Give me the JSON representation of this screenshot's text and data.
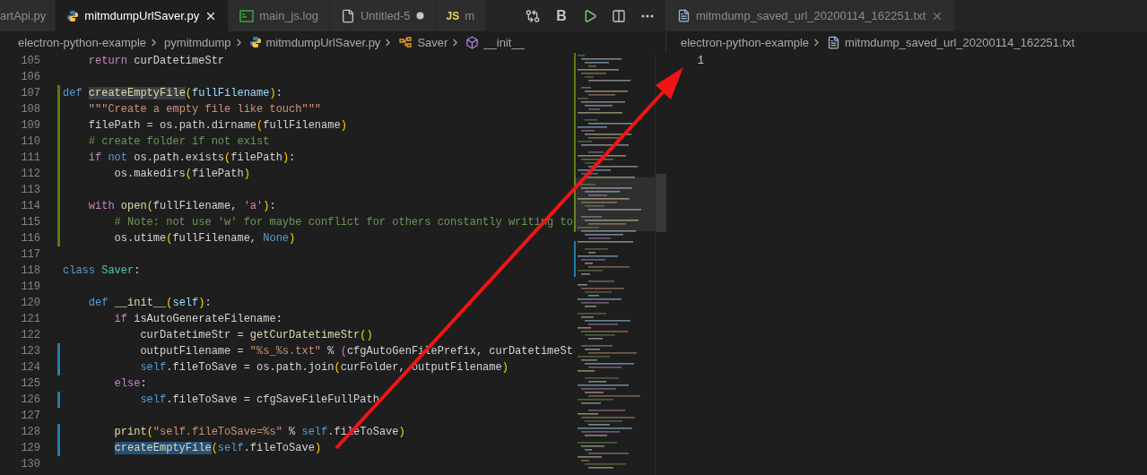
{
  "left_editor": {
    "tabs": [
      {
        "label": "artApi.py",
        "kind": "plain",
        "selected": false,
        "unsaved": false
      },
      {
        "label": "mitmdumpUrlSaver.py",
        "kind": "python",
        "selected": true,
        "unsaved": false
      },
      {
        "label": "main_js.log",
        "kind": "log",
        "selected": false,
        "unsaved": false
      },
      {
        "label": "Untitled-5",
        "kind": "file",
        "selected": false,
        "unsaved": true
      },
      {
        "label": "m",
        "kind": "js",
        "badge": "JS",
        "selected": false,
        "unsaved": false
      }
    ],
    "toolbar": [
      {
        "kind": "compare"
      },
      {
        "kind": "text",
        "label": "B"
      },
      {
        "kind": "run"
      },
      {
        "kind": "split"
      },
      {
        "kind": "more"
      }
    ],
    "breadcrumb": [
      {
        "label": "electron-python-example",
        "kind": "plain"
      },
      {
        "label": "pymitmdump",
        "kind": "plain"
      },
      {
        "label": "mitmdumpUrlSaver.py",
        "kind": "python"
      },
      {
        "label": "Saver",
        "kind": "class"
      },
      {
        "label": "__init__",
        "kind": "method"
      }
    ],
    "lines": [
      {
        "number": "105",
        "tokens": [
          {
            "text": "    return",
            "kind": "keyword"
          },
          {
            "text": " curDatetimeStr",
            "kind": "plain"
          }
        ]
      },
      {
        "number": "106"
      },
      {
        "number": "107",
        "added": true,
        "tokens": [
          {
            "text": "def ",
            "kind": "storage"
          },
          {
            "text": "createEmptyFile",
            "kind": "function",
            "occurrence": true
          },
          {
            "text": "(",
            "kind": "bracket"
          },
          {
            "text": "fullFilename",
            "kind": "param"
          },
          {
            "text": ")",
            "kind": "bracket"
          },
          {
            "text": ":",
            "kind": "plain"
          }
        ]
      },
      {
        "number": "108",
        "added": true,
        "tokens": [
          {
            "text": "    \"\"\"Create a empty file like touch\"\"\"",
            "kind": "string"
          }
        ]
      },
      {
        "number": "109",
        "added": true,
        "tokens": [
          {
            "text": "    filePath = os.path.dirname",
            "kind": "plain"
          },
          {
            "text": "(",
            "kind": "bracket"
          },
          {
            "text": "fullFilename",
            "kind": "plain"
          },
          {
            "text": ")",
            "kind": "bracket"
          }
        ]
      },
      {
        "number": "110",
        "added": true,
        "tokens": [
          {
            "text": "    # create folder if not exist",
            "kind": "comment"
          }
        ]
      },
      {
        "number": "111",
        "added": true,
        "tokens": [
          {
            "text": "    if ",
            "kind": "keyword"
          },
          {
            "text": "not",
            "kind": "storage"
          },
          {
            "text": " os.path.exists",
            "kind": "plain"
          },
          {
            "text": "(",
            "kind": "bracket"
          },
          {
            "text": "filePath",
            "kind": "plain"
          },
          {
            "text": ")",
            "kind": "bracket"
          },
          {
            "text": ":",
            "kind": "plain"
          }
        ]
      },
      {
        "number": "112",
        "added": true,
        "tokens": [
          {
            "text": "        os.makedirs",
            "kind": "plain"
          },
          {
            "text": "(",
            "kind": "bracket"
          },
          {
            "text": "filePath",
            "kind": "plain"
          },
          {
            "text": ")",
            "kind": "bracket"
          }
        ]
      },
      {
        "number": "113",
        "added": true
      },
      {
        "number": "114",
        "added": true,
        "tokens": [
          {
            "text": "    with ",
            "kind": "keyword"
          },
          {
            "text": "open",
            "kind": "function"
          },
          {
            "text": "(",
            "kind": "bracket"
          },
          {
            "text": "fullFilename, ",
            "kind": "plain"
          },
          {
            "text": "'a'",
            "kind": "string"
          },
          {
            "text": ")",
            "kind": "bracket"
          },
          {
            "text": ":",
            "kind": "plain"
          }
        ]
      },
      {
        "number": "115",
        "added": true,
        "tokens": [
          {
            "text": "        # Note: not use 'w' for maybe conflict for others constantly writing to",
            "kind": "comment"
          }
        ]
      },
      {
        "number": "116",
        "added": true,
        "tokens": [
          {
            "text": "        os.utime",
            "kind": "plain"
          },
          {
            "text": "(",
            "kind": "bracket"
          },
          {
            "text": "fullFilename, ",
            "kind": "plain"
          },
          {
            "text": "None",
            "kind": "storage"
          },
          {
            "text": ")",
            "kind": "bracket"
          }
        ]
      },
      {
        "number": "117"
      },
      {
        "number": "118",
        "tokens": [
          {
            "text": "class ",
            "kind": "storage"
          },
          {
            "text": "Saver",
            "kind": "class"
          },
          {
            "text": ":",
            "kind": "plain"
          }
        ]
      },
      {
        "number": "119"
      },
      {
        "number": "120",
        "tokens": [
          {
            "text": "    def ",
            "kind": "storage"
          },
          {
            "text": "__init__",
            "kind": "function"
          },
          {
            "text": "(",
            "kind": "bracket"
          },
          {
            "text": "self",
            "kind": "param"
          },
          {
            "text": ")",
            "kind": "bracket"
          },
          {
            "text": ":",
            "kind": "plain"
          }
        ]
      },
      {
        "number": "121",
        "tokens": [
          {
            "text": "        if",
            "kind": "keyword"
          },
          {
            "text": " isAutoGenerateFilename:",
            "kind": "plain"
          }
        ]
      },
      {
        "number": "122",
        "tokens": [
          {
            "text": "            curDatetimeStr = ",
            "kind": "plain"
          },
          {
            "text": "getCurDatetimeStr",
            "kind": "function"
          },
          {
            "text": "()",
            "kind": "bracket"
          }
        ]
      },
      {
        "number": "123",
        "modified": true,
        "tokens": [
          {
            "text": "            outputFilename = ",
            "kind": "plain"
          },
          {
            "text": "\"%s_%s.txt\"",
            "kind": "string"
          },
          {
            "text": " % ",
            "kind": "plain"
          },
          {
            "text": "(",
            "kind": "bracket2"
          },
          {
            "text": "cfgAutoGenFilePrefix, curDatetimeSt",
            "kind": "plain"
          }
        ]
      },
      {
        "number": "124",
        "modified": true,
        "tokens": [
          {
            "text": "            self",
            "kind": "storage"
          },
          {
            "text": ".fileToSave = os.path.join",
            "kind": "plain"
          },
          {
            "text": "(",
            "kind": "bracket"
          },
          {
            "text": "curFolder, outputFilename",
            "kind": "plain"
          },
          {
            "text": ")",
            "kind": "bracket"
          }
        ]
      },
      {
        "number": "125",
        "tokens": [
          {
            "text": "        else",
            "kind": "keyword"
          },
          {
            "text": ":",
            "kind": "plain"
          }
        ]
      },
      {
        "number": "126",
        "modified": true,
        "tokens": [
          {
            "text": "            self",
            "kind": "storage"
          },
          {
            "text": ".fileToSave = cfgSaveFileFullPath",
            "kind": "plain"
          }
        ]
      },
      {
        "number": "127"
      },
      {
        "number": "128",
        "modified": true,
        "tokens": [
          {
            "text": "        print",
            "kind": "function"
          },
          {
            "text": "(",
            "kind": "bracket"
          },
          {
            "text": "\"self.fileToSave=%s\"",
            "kind": "string"
          },
          {
            "text": " % ",
            "kind": "plain"
          },
          {
            "text": "self",
            "kind": "storage"
          },
          {
            "text": ".fileToSave",
            "kind": "plain"
          },
          {
            "text": ")",
            "kind": "bracket"
          }
        ]
      },
      {
        "number": "129",
        "modified": true,
        "tokens": [
          {
            "text": "        createEmptyFile",
            "kind": "function",
            "selected": true
          },
          {
            "text": "(",
            "kind": "bracket"
          },
          {
            "text": "self",
            "kind": "storage"
          },
          {
            "text": ".fileToSave",
            "kind": "plain"
          },
          {
            "text": ")",
            "kind": "bracket"
          }
        ]
      },
      {
        "number": "130"
      }
    ]
  },
  "right_editor": {
    "tab": {
      "label": "mitmdump_saved_url_20200114_162251.txt",
      "selected": false
    },
    "breadcrumb": [
      {
        "label": "electron-python-example",
        "kind": "plain"
      },
      {
        "label": "mitmdump_saved_url_20200114_162251.txt",
        "kind": "text"
      }
    ],
    "lines": [
      {
        "number": "1"
      }
    ]
  }
}
